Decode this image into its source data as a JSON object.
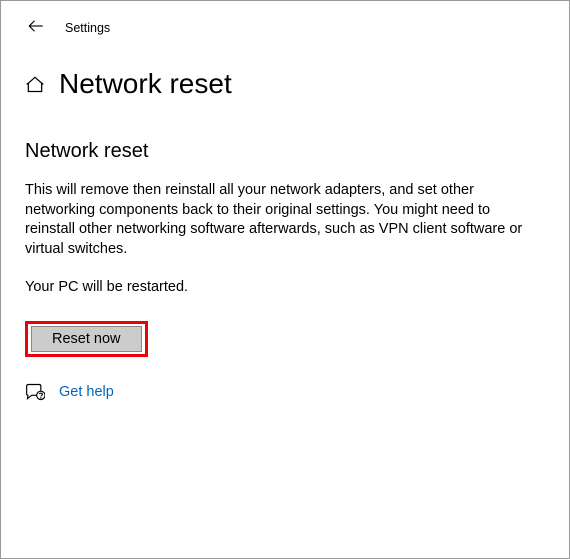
{
  "app": {
    "title": "Settings"
  },
  "header": {
    "page_title": "Network reset"
  },
  "main": {
    "section_title": "Network reset",
    "description": "This will remove then reinstall all your network adapters, and set other networking components back to their original settings. You might need to reinstall other networking software afterwards, such as VPN client software or virtual switches.",
    "restart_note": "Your PC will be restarted.",
    "reset_button_label": "Reset now"
  },
  "help": {
    "label": "Get help"
  }
}
